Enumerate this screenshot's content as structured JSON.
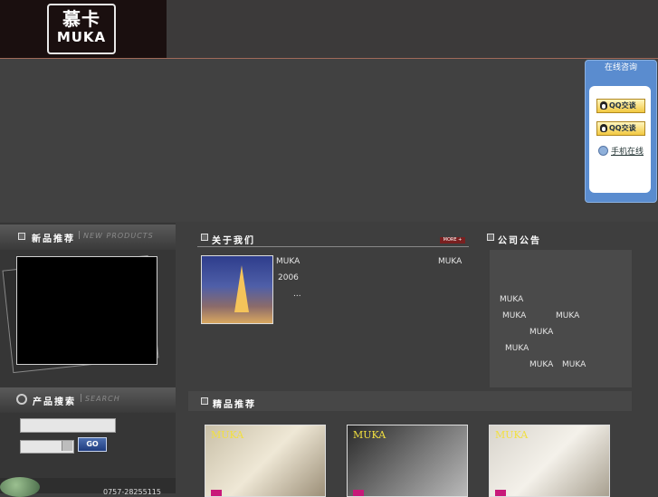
{
  "logo": {
    "cn": "慕卡",
    "en": "MUKA"
  },
  "sections": {
    "new_products": {
      "cn": "新品推荐",
      "en": "NEW PRODUCTS"
    },
    "search": {
      "cn": "产品搜索",
      "en": "SEARCH",
      "go_label": "GO"
    },
    "about": {
      "cn": "关于我们",
      "more": "MORE +"
    },
    "notice": {
      "cn": "公司公告"
    },
    "featured": {
      "cn": "精品推荐"
    }
  },
  "about": {
    "line1_left": "MUKA",
    "line1_right": "MUKA",
    "line2": "2006",
    "line3": "..."
  },
  "notice_lines": [
    "MUKA",
    "MUKA",
    "MUKA",
    "MUKA",
    "MUKA",
    "MUKA",
    "MUKA"
  ],
  "products": [
    {
      "label": "MUKA"
    },
    {
      "label": "MUKA"
    },
    {
      "label": "MUKA"
    }
  ],
  "footer": {
    "phone": "0757-28255115"
  },
  "qq": {
    "title": "在线咨询",
    "button1": "QQ交谈",
    "button2": "QQ交谈",
    "mobile": "手机在线"
  }
}
